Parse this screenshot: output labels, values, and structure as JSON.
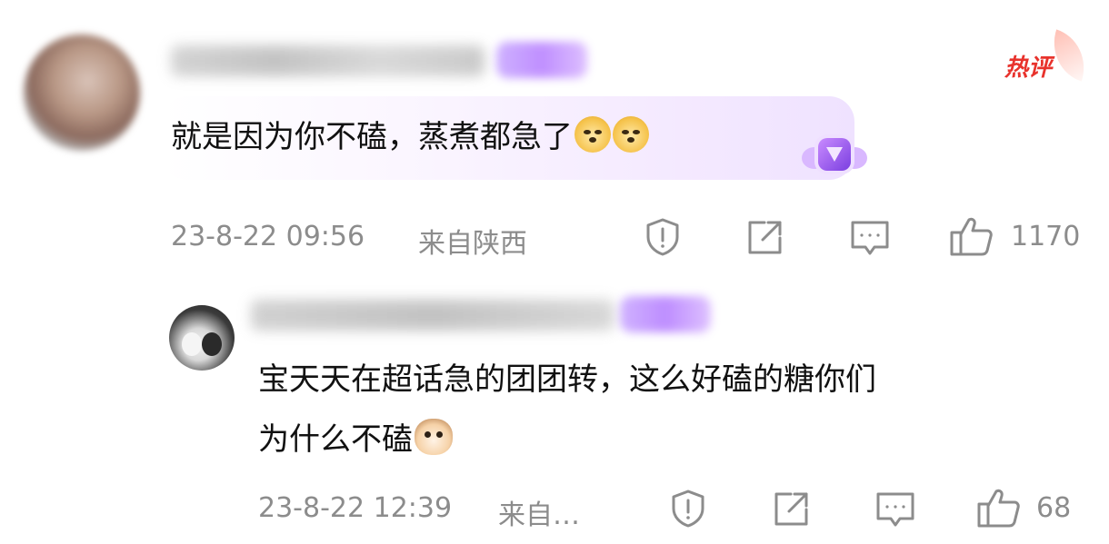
{
  "hot_label": "热评",
  "comment": {
    "text": "就是因为你不磕，蒸煮都急了",
    "emojis": [
      "doge-icon",
      "doge-icon"
    ],
    "time": "23-8-22 09:56",
    "location": "来自陕西",
    "likes": "1170"
  },
  "reply": {
    "line1": "宝天天在超话急的团团转，这么好磕的糖你们",
    "line2": "为什么不磕",
    "emojis": [
      "cat-icon"
    ],
    "time": "23-8-22 12:39",
    "location": "来自…",
    "likes": "68"
  },
  "colors": {
    "hot_red": "#e8322c",
    "meta_gray": "#8c8c8c",
    "badge_purple": "#b57cff"
  }
}
